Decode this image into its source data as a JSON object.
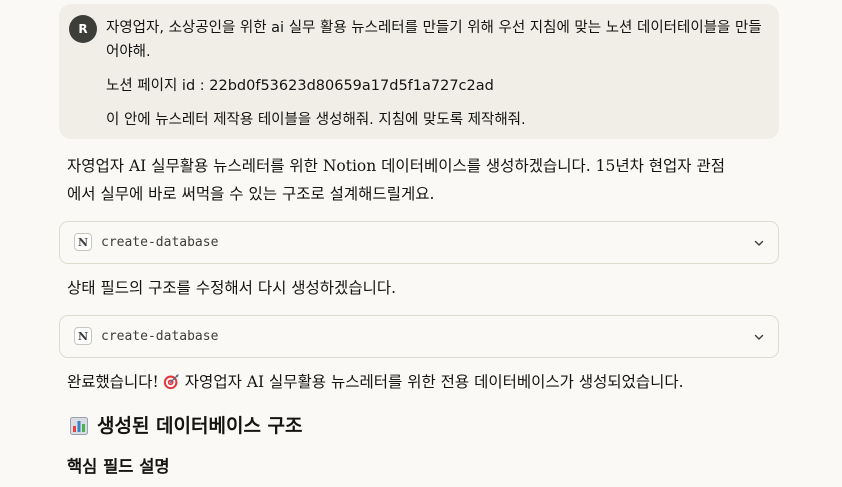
{
  "user_message": {
    "avatar_initial": "R",
    "line1": "자영업자, 소상공인을 위한 ai 실무 활용 뉴스레터를 만들기 위해 우선 지침에 맞는 노션 데이터테이블을 만들어야해.",
    "line2": "노션 페이지 id : 22bd0f53623d80659a17d5f1a727c2ad",
    "line3": "이 안에 뉴스레터 제작용 테이블을 생성해줘. 지침에 맞도록 제작해줘."
  },
  "assistant": {
    "intro_line1": "자영업자 AI 실무활용 뉴스레터를 위한 Notion 데이터베이스를 생성하겠습니다. 15년차 현업자 관점",
    "intro_line2": "에서 실무에 바로 써먹을 수 있는 구조로 설계해드릴게요.",
    "tool_call_1": {
      "icon_letter": "N",
      "label": "create-database"
    },
    "retry_text": "상태 필드의 구조를 수정해서 다시 생성하겠습니다.",
    "tool_call_2": {
      "icon_letter": "N",
      "label": "create-database"
    },
    "done_text_prefix": "완료했습니다!",
    "done_text_suffix": "자영업자 AI 실무활용 뉴스레터를 위한 전용 데이터베이스가 생성되었습니다.",
    "heading_structure": "생성된 데이터베이스 구조",
    "heading_fields": "핵심 필드 설명"
  },
  "icons": {
    "avatar": "user-avatar",
    "tool": "notion-icon",
    "chevron": "chevron-down-icon",
    "target": "direct-hit-icon",
    "chart": "bar-chart-icon"
  },
  "colors": {
    "background": "#faf9f5",
    "user_bubble": "#f0eee6",
    "avatar_bg": "#3d3d3a",
    "border": "#dedcd1",
    "text": "#141413"
  }
}
